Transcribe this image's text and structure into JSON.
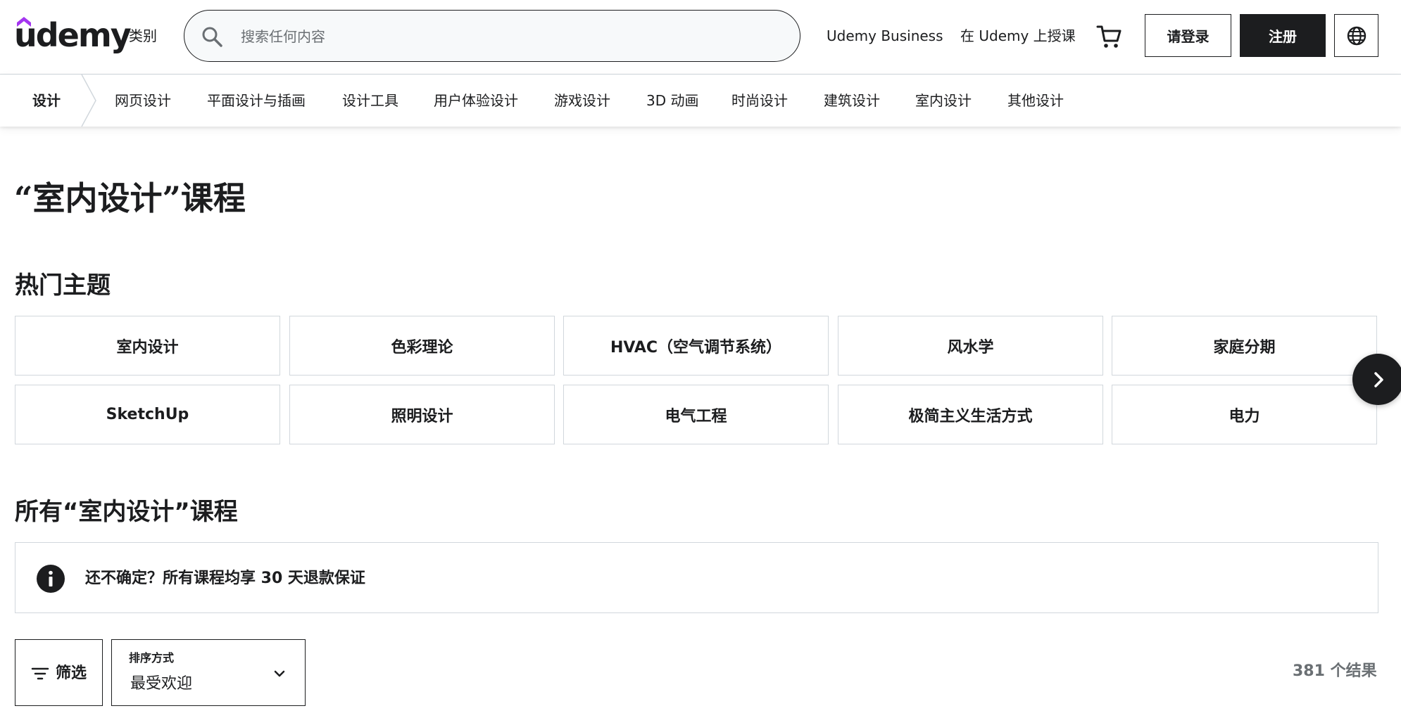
{
  "colors": {
    "text": "#1c1d1f",
    "muted": "#6a6f73",
    "border": "#d1d7dc",
    "brand_purple": "#a435f0"
  },
  "header": {
    "logo_text": "udemy",
    "categories_label": "类别",
    "search": {
      "placeholder": "搜索任何内容",
      "value": "",
      "icon": "search-icon"
    },
    "business_link": "Udemy Business",
    "teach_link": "在 Udemy 上授课",
    "cart_icon": "cart-icon",
    "login_label": "请登录",
    "signup_label": "注册",
    "language_icon": "globe-icon"
  },
  "subnav": {
    "current": "设计",
    "items": [
      "网页设计",
      "平面设计与插画",
      "设计工具",
      "用户体验设计",
      "游戏设计",
      "3D 动画",
      "时尚设计",
      "建筑设计",
      "室内设计",
      "其他设计"
    ]
  },
  "main": {
    "page_title": "“室内设计”课程",
    "popular_topics_title": "热门主题",
    "topics": [
      "室内设计",
      "色彩理论",
      "HVAC（空气调节系统）",
      "风水学",
      "家庭分期",
      "SketchUp",
      "照明设计",
      "电气工程",
      "极简主义生活方式",
      "电力"
    ],
    "all_courses_title": "所有“室内设计”课程",
    "banner_text": "还不确定？所有课程均享 30 天退款保证",
    "filter_label": "筛选",
    "sort_label": "排序方式",
    "sort_value": "最受欢迎",
    "result_count": "381 个结果"
  }
}
